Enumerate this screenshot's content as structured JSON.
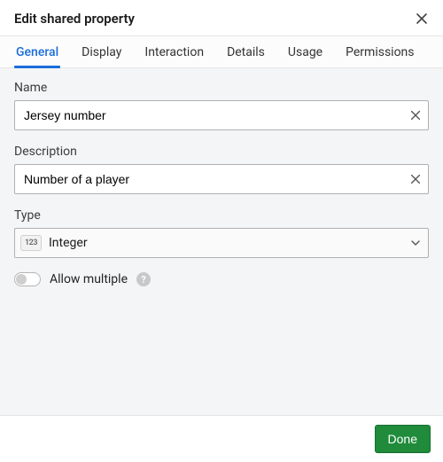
{
  "dialog": {
    "title": "Edit shared property"
  },
  "tabs": {
    "items": [
      {
        "label": "General"
      },
      {
        "label": "Display"
      },
      {
        "label": "Interaction"
      },
      {
        "label": "Details"
      },
      {
        "label": "Usage"
      },
      {
        "label": "Permissions"
      }
    ],
    "active_index": 0
  },
  "form": {
    "name": {
      "label": "Name",
      "value": "Jersey number"
    },
    "description": {
      "label": "Description",
      "value": "Number of a player"
    },
    "type": {
      "label": "Type",
      "icon_text": "123",
      "selected": "Integer"
    },
    "allow_multiple": {
      "label": "Allow multiple",
      "value": false
    }
  },
  "footer": {
    "done_label": "Done"
  }
}
